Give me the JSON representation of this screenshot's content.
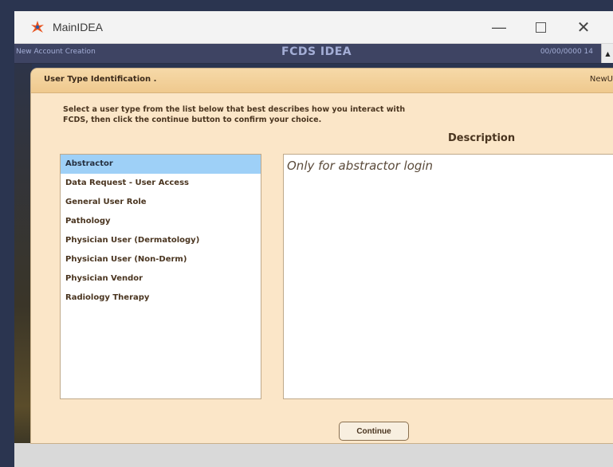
{
  "window": {
    "title": "MainIDEA",
    "minimize_glyph": "—",
    "close_glyph": "✕"
  },
  "appbar": {
    "left_text": "New Account Creation",
    "center_text": "FCDS IDEA",
    "right_text": "00/00/0000 14"
  },
  "dialog": {
    "title": "User Type Identification .",
    "right_text": "NewU",
    "instructions": "Select a user type from the list below that best describes how you interact with FCDS, then click the continue button to confirm your choice.",
    "description_heading": "Description",
    "user_types": [
      "Abstractor",
      "Data Request - User Access",
      "General User Role",
      "Pathology",
      "Physician User (Dermatology)",
      "Physician User (Non-Derm)",
      "Physician Vendor",
      "Radiology Therapy"
    ],
    "selected_user_type": "Abstractor",
    "description_text": "Only for abstractor login",
    "continue_label": "Continue"
  },
  "colors": {
    "dialog_bg": "#fbe6c8",
    "header_bg": "#efc98e",
    "selected_bg": "#9ed0f7",
    "appbar_bg": "#3e4463",
    "icon_accent": "#e8521e"
  }
}
